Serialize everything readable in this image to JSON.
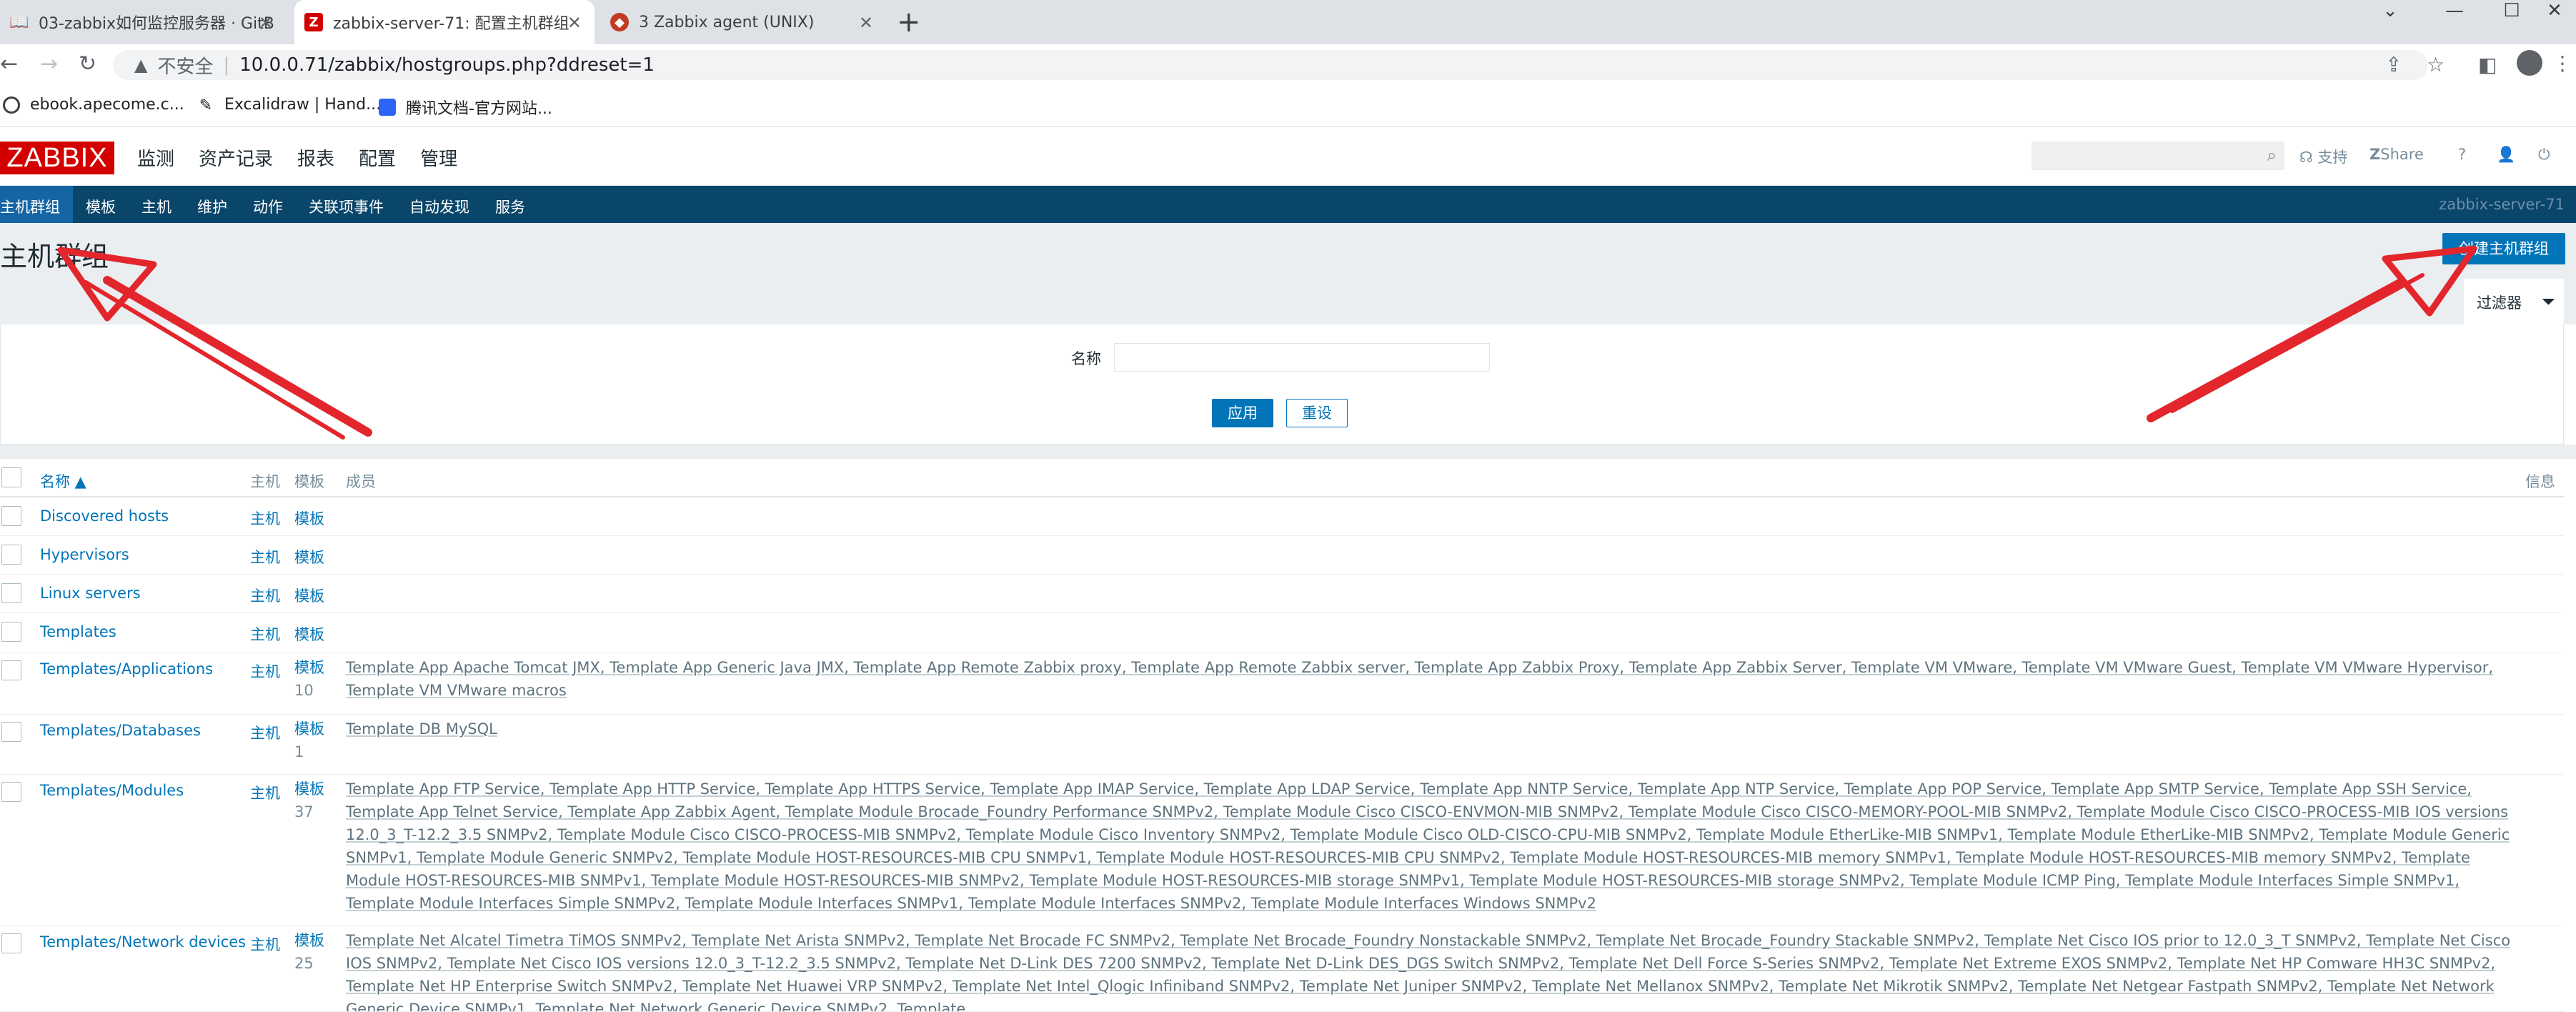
{
  "browser": {
    "tabs": [
      {
        "title": "03-zabbix如何监控服务器 · GitB"
      },
      {
        "title": "zabbix-server-71: 配置主机群组"
      },
      {
        "title": "3 Zabbix agent (UNIX)"
      }
    ],
    "address": {
      "security": "不安全",
      "url": "10.0.0.71/zabbix/hostgroups.php?ddreset=1"
    },
    "bookmarks": [
      {
        "label": "ebook.apecome.c..."
      },
      {
        "label": "Excalidraw | Hand..."
      },
      {
        "label": "腾讯文档-官方网站..."
      }
    ]
  },
  "zabbix": {
    "logo": "ZABBIX",
    "main_menu": [
      "监测",
      "资产记录",
      "报表",
      "配置",
      "管理"
    ],
    "header_right": {
      "support": "支持",
      "share": "Share",
      "help": "?"
    },
    "sub_menu": [
      "主机群组",
      "模板",
      "主机",
      "维护",
      "动作",
      "关联项事件",
      "自动发现",
      "服务"
    ],
    "server_name": "zabbix-server-71",
    "page_title": "主机群组",
    "create_button": "创建主机群组",
    "filter": {
      "tab_label": "过滤器",
      "name_label": "名称",
      "name_value": "",
      "apply": "应用",
      "reset": "重设"
    },
    "table": {
      "headers": {
        "name": "名称 ▲",
        "hosts": "主机",
        "templates": "模板",
        "members": "成员",
        "info": "信息"
      },
      "rows": [
        {
          "name": "Discovered hosts",
          "hosts": "主机",
          "templates": "模板",
          "count": "",
          "members": ""
        },
        {
          "name": "Hypervisors",
          "hosts": "主机",
          "templates": "模板",
          "count": "",
          "members": ""
        },
        {
          "name": "Linux servers",
          "hosts": "主机",
          "templates": "模板",
          "count": "",
          "members": ""
        },
        {
          "name": "Templates",
          "hosts": "主机",
          "templates": "模板",
          "count": "",
          "members": ""
        },
        {
          "name": "Templates/Applications",
          "hosts": "主机",
          "templates": "模板",
          "count": "10",
          "members": "Template App Apache Tomcat JMX, Template App Generic Java JMX, Template App Remote Zabbix proxy, Template App Remote Zabbix server, Template App Zabbix Proxy, Template App Zabbix Server, Template VM VMware, Template VM VMware Guest, Template VM VMware Hypervisor, Template VM VMware macros"
        },
        {
          "name": "Templates/Databases",
          "hosts": "主机",
          "templates": "模板",
          "count": "1",
          "members": "Template DB MySQL"
        },
        {
          "name": "Templates/Modules",
          "hosts": "主机",
          "templates": "模板",
          "count": "37",
          "members": "Template App FTP Service, Template App HTTP Service, Template App HTTPS Service, Template App IMAP Service, Template App LDAP Service, Template App NNTP Service, Template App NTP Service, Template App POP Service, Template App SMTP Service, Template App SSH Service, Template App Telnet Service, Template App Zabbix Agent, Template Module Brocade_Foundry Performance SNMPv2, Template Module Cisco CISCO-ENVMON-MIB SNMPv2, Template Module Cisco CISCO-MEMORY-POOL-MIB SNMPv2, Template Module Cisco CISCO-PROCESS-MIB IOS versions 12.0_3_T-12.2_3.5 SNMPv2, Template Module Cisco CISCO-PROCESS-MIB SNMPv2, Template Module Cisco Inventory SNMPv2, Template Module Cisco OLD-CISCO-CPU-MIB SNMPv2, Template Module EtherLike-MIB SNMPv1, Template Module EtherLike-MIB SNMPv2, Template Module Generic SNMPv1, Template Module Generic SNMPv2, Template Module HOST-RESOURCES-MIB CPU SNMPv1, Template Module HOST-RESOURCES-MIB CPU SNMPv2, Template Module HOST-RESOURCES-MIB memory SNMPv1, Template Module HOST-RESOURCES-MIB memory SNMPv2, Template Module HOST-RESOURCES-MIB SNMPv1, Template Module HOST-RESOURCES-MIB SNMPv2, Template Module HOST-RESOURCES-MIB storage SNMPv1, Template Module HOST-RESOURCES-MIB storage SNMPv2, Template Module ICMP Ping, Template Module Interfaces Simple SNMPv1, Template Module Interfaces Simple SNMPv2, Template Module Interfaces SNMPv1, Template Module Interfaces SNMPv2, Template Module Interfaces Windows SNMPv2"
        },
        {
          "name": "Templates/Network devices",
          "hosts": "主机",
          "templates": "模板",
          "count": "25",
          "members": "Template Net Alcatel Timetra TiMOS SNMPv2, Template Net Arista SNMPv2, Template Net Brocade FC SNMPv2, Template Net Brocade_Foundry Nonstackable SNMPv2, Template Net Brocade_Foundry Stackable SNMPv2, Template Net Cisco IOS prior to 12.0_3_T SNMPv2, Template Net Cisco IOS SNMPv2, Template Net Cisco IOS versions 12.0_3_T-12.2_3.5 SNMPv2, Template Net D-Link DES 7200 SNMPv2, Template Net D-Link DES_DGS Switch SNMPv2, Template Net Dell Force S-Series SNMPv2, Template Net Extreme EXOS SNMPv2, Template Net HP Comware HH3C SNMPv2, Template Net HP Enterprise Switch SNMPv2, Template Net Huawei VRP SNMPv2, Template Net Intel_Qlogic Infiniband SNMPv2, Template Net Juniper SNMPv2, Template Net Mellanox SNMPv2, Template Net Mikrotik SNMPv2, Template Net Netgear Fastpath SNMPv2, Template Net Network Generic Device SNMPv1, Template Net Network Generic Device SNMPv2, Template"
        }
      ]
    }
  },
  "colors": {
    "brand": "#d40000",
    "subnav": "#0a466a",
    "accent": "#0275b8",
    "arrow": "#e3262c"
  },
  "icons": [
    "back-icon",
    "forward-icon",
    "reload-icon",
    "warning-icon",
    "share-icon",
    "star-icon",
    "sidebar-icon",
    "search-icon",
    "headset-icon",
    "user-icon",
    "power-icon",
    "filter-icon"
  ]
}
